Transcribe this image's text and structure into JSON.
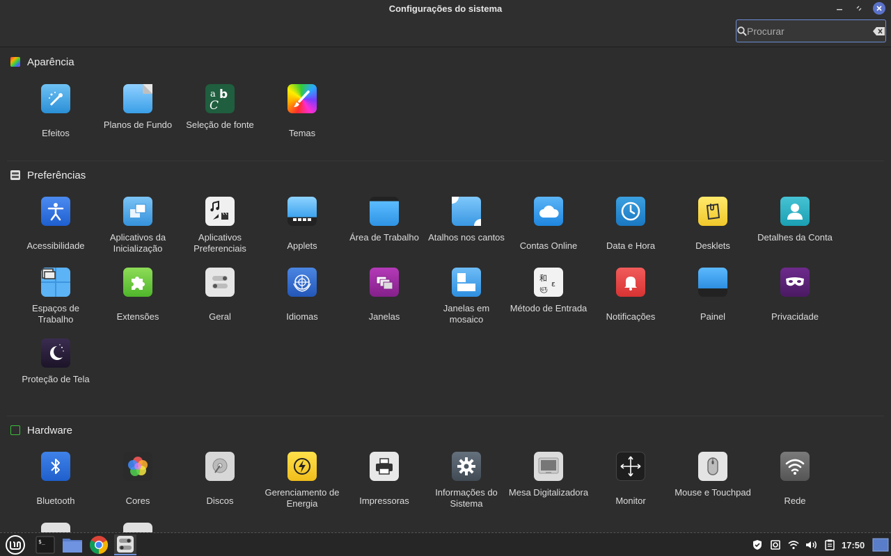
{
  "window": {
    "title": "Configurações do sistema",
    "search_placeholder": "Procurar",
    "search_value": ""
  },
  "sections": {
    "appearance": {
      "title": "Aparência"
    },
    "preferences": {
      "title": "Preferências"
    },
    "hardware": {
      "title": "Hardware"
    }
  },
  "appearance_items": [
    {
      "label": "Efeitos",
      "icon": "effects-icon"
    },
    {
      "label": "Planos de Fundo",
      "icon": "backgrounds-icon"
    },
    {
      "label": "Seleção de fonte",
      "icon": "font-selection-icon"
    },
    {
      "label": "Temas",
      "icon": "themes-icon"
    }
  ],
  "preferences_items": [
    {
      "label": "Acessibilidade",
      "icon": "accessibility-icon"
    },
    {
      "label": "Aplicativos da Inicialização",
      "icon": "startup-apps-icon"
    },
    {
      "label": "Aplicativos Preferenciais",
      "icon": "preferred-apps-icon"
    },
    {
      "label": "Applets",
      "icon": "applets-icon"
    },
    {
      "label": "Área de Trabalho",
      "icon": "desktop-icon"
    },
    {
      "label": "Atalhos nos cantos",
      "icon": "hot-corners-icon"
    },
    {
      "label": "Contas Online",
      "icon": "online-accounts-icon"
    },
    {
      "label": "Data e Hora",
      "icon": "clock-icon"
    },
    {
      "label": "Desklets",
      "icon": "desklets-icon"
    },
    {
      "label": "Detalhes da Conta",
      "icon": "account-details-icon"
    },
    {
      "label": "Espaços de Trabalho",
      "icon": "workspaces-icon"
    },
    {
      "label": "Extensões",
      "icon": "extensions-icon"
    },
    {
      "label": "Geral",
      "icon": "general-icon"
    },
    {
      "label": "Idiomas",
      "icon": "languages-icon"
    },
    {
      "label": "Janelas",
      "icon": "windows-icon"
    },
    {
      "label": "Janelas em mosaico",
      "icon": "window-tiling-icon"
    },
    {
      "label": "Método de Entrada",
      "icon": "input-method-icon"
    },
    {
      "label": "Notificações",
      "icon": "notifications-icon"
    },
    {
      "label": "Painel",
      "icon": "panel-icon"
    },
    {
      "label": "Privacidade",
      "icon": "privacy-icon"
    },
    {
      "label": "Proteção de Tela",
      "icon": "screensaver-icon"
    }
  ],
  "hardware_items": [
    {
      "label": "Bluetooth",
      "icon": "bluetooth-icon"
    },
    {
      "label": "Cores",
      "icon": "color-icon"
    },
    {
      "label": "Discos",
      "icon": "disks-icon"
    },
    {
      "label": "Gerenciamento de Energia",
      "icon": "power-icon"
    },
    {
      "label": "Impressoras",
      "icon": "printer-icon"
    },
    {
      "label": "Informações do Sistema",
      "icon": "system-info-icon"
    },
    {
      "label": "Mesa Digitalizadora",
      "icon": "tablet-icon"
    },
    {
      "label": "Monitor",
      "icon": "display-icon"
    },
    {
      "label": "Mouse e Touchpad",
      "icon": "mouse-icon"
    },
    {
      "label": "Rede",
      "icon": "network-icon"
    }
  ],
  "taskbar": {
    "clock": "17:50"
  }
}
